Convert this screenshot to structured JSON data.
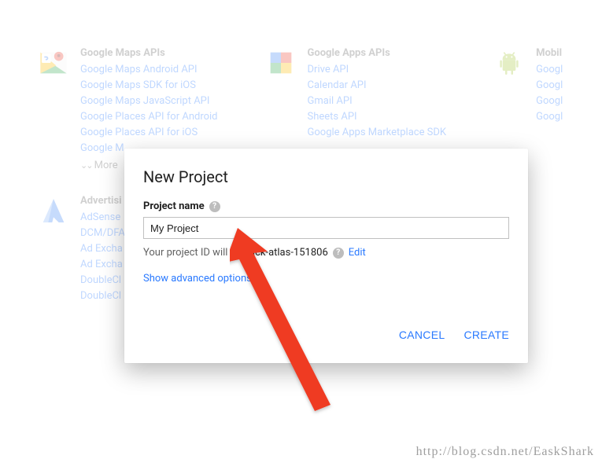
{
  "sections": {
    "maps": {
      "title": "Google Maps APIs",
      "links": [
        "Google Maps Android API",
        "Google Maps SDK for iOS",
        "Google Maps JavaScript API",
        "Google Places API for Android",
        "Google Places API for iOS",
        "Google M"
      ],
      "more": "More"
    },
    "apps": {
      "title": "Google Apps APIs",
      "links": [
        "Drive API",
        "Calendar API",
        "Gmail API",
        "Sheets API",
        "Google Apps Marketplace SDK"
      ]
    },
    "mobile": {
      "title": "Mobil",
      "links": [
        "Googl",
        "Googl",
        "Googl",
        "Googl"
      ]
    },
    "advertising": {
      "title": "Advertisi",
      "links": [
        "AdSense",
        "DCM/DFA",
        "Ad Excha",
        "Ad Excha",
        "DoubleCl",
        "DoubleCl"
      ]
    }
  },
  "modal": {
    "title": "New Project",
    "project_name_label": "Project name",
    "project_name_value": "My Project",
    "project_id_prefix": "Your project ID will be",
    "project_id_value": "rack-atlas-151806",
    "edit_label": "Edit",
    "advanced_label": "Show advanced options...",
    "cancel_label": "CANCEL",
    "create_label": "CREATE"
  },
  "watermark": "http://blog.csdn.net/EaskShark"
}
